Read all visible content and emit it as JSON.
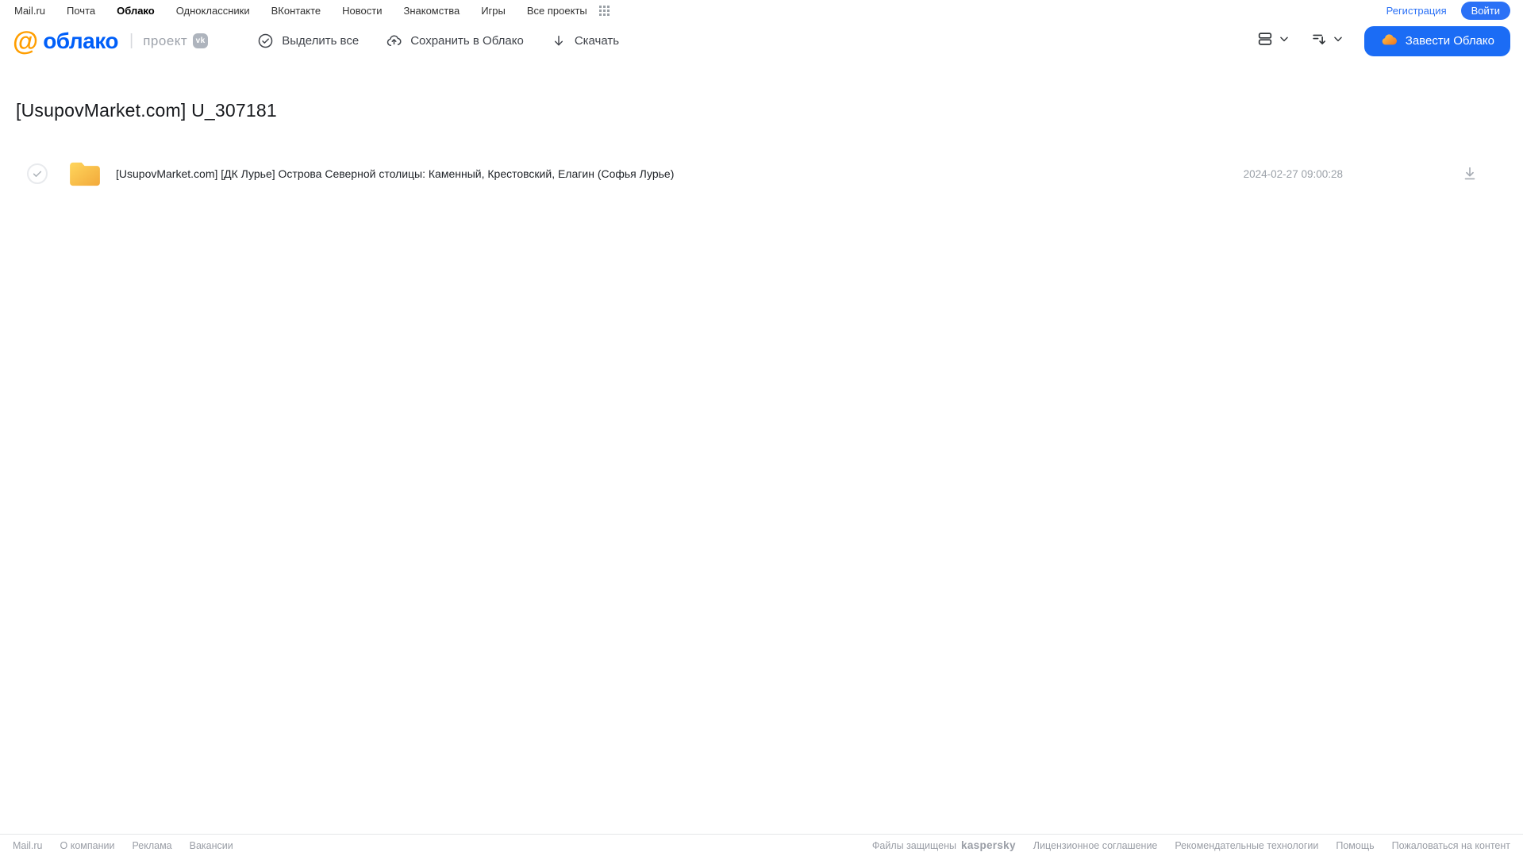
{
  "topbar": {
    "links": [
      {
        "label": "Mail.ru"
      },
      {
        "label": "Почта"
      },
      {
        "label": "Облако"
      },
      {
        "label": "Одноклассники"
      },
      {
        "label": "ВКонтакте"
      },
      {
        "label": "Новости"
      },
      {
        "label": "Знакомства"
      },
      {
        "label": "Игры"
      },
      {
        "label": "Все проекты"
      }
    ],
    "registration_label": "Регистрация",
    "login_label": "Войти"
  },
  "header": {
    "logo_at": "@",
    "logo_text": "облако",
    "project_label": "проект",
    "vk_badge": "vk",
    "toolbar": {
      "select_all": "Выделить все",
      "save_to_cloud": "Сохранить в Облако",
      "download": "Скачать"
    },
    "create_cloud_label": "Завести Облако"
  },
  "main": {
    "title": "[UsupovMarket.com] U_307181",
    "files": [
      {
        "type": "folder",
        "name": "[UsupovMarket.com] [ДК Лурье] Острова Северной столицы: Каменный, Крестовский, Елагин (Софья Лурье)",
        "date": "2024-02-27 09:00:28"
      }
    ]
  },
  "footer": {
    "left_links": [
      "Mail.ru",
      "О компании",
      "Реклама",
      "Вакансии"
    ],
    "protected_label": "Файлы защищены",
    "kaspersky_label": "kaspersky",
    "right_links": [
      "Лицензионное соглашение",
      "Рекомендательные технологии",
      "Помощь",
      "Пожаловаться на контент"
    ]
  },
  "colors": {
    "accent_blue": "#005ff9",
    "button_blue": "#1b6cf5",
    "logo_orange": "#ff9e00",
    "folder_yellow": "#f7b733",
    "kaspersky_green": "#006d5c"
  }
}
